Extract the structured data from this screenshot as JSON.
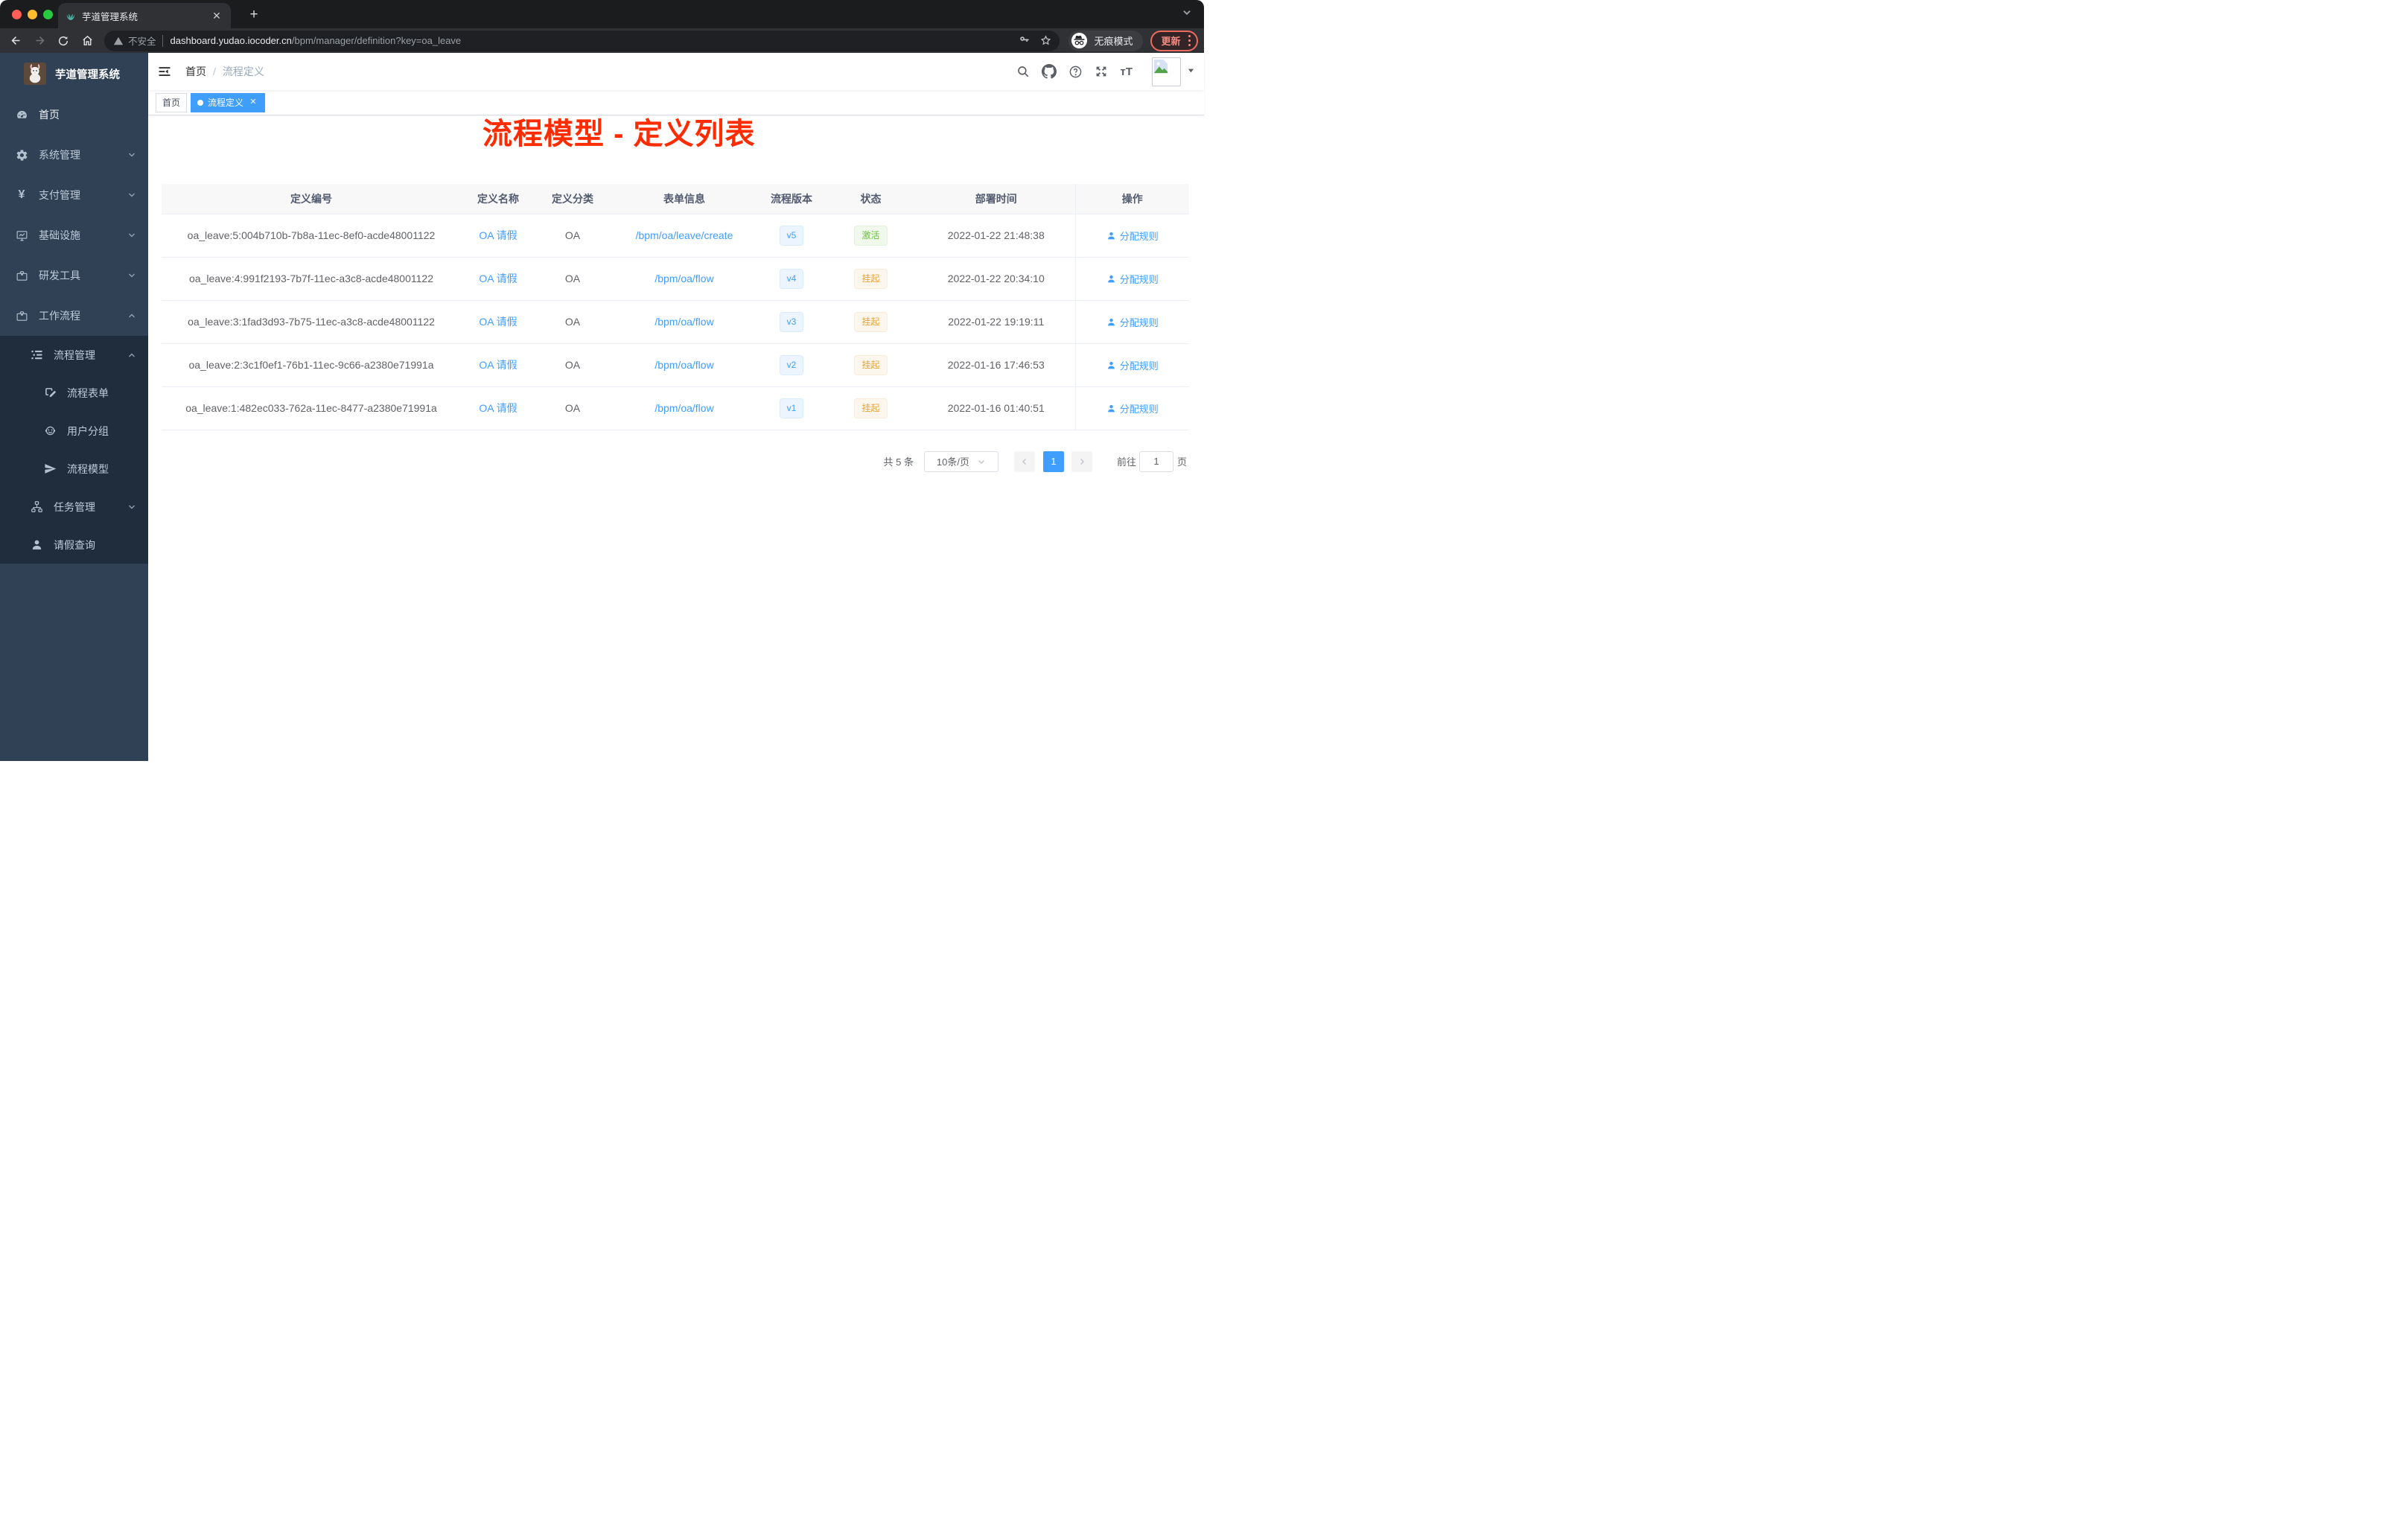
{
  "colors": {
    "accent": "#409eff",
    "success": "#67c23a",
    "warning": "#e6a23c",
    "annotation_red": "#fe2c00",
    "sidebar_bg": "#304156",
    "sidebar_submenu_bg": "#1f2d3d"
  },
  "browser": {
    "tab_title": "芋道管理系统",
    "security_label": "不安全",
    "url_domain": "dashboard.yudao.iocoder.cn",
    "url_path": "/bpm/manager/definition?key=oa_leave",
    "incognito_label": "无痕模式",
    "update_label": "更新"
  },
  "annotation": {
    "title": "流程模型 - 定义列表"
  },
  "sidebar": {
    "app_title": "芋道管理系统",
    "items": [
      {
        "key": "home",
        "label": "首页",
        "icon": "dashboard-icon",
        "level": 1,
        "bright": true
      },
      {
        "key": "system",
        "label": "系统管理",
        "icon": "gear-icon",
        "level": 1,
        "chevron": "down"
      },
      {
        "key": "payment",
        "label": "支付管理",
        "icon": "yen-icon",
        "level": 1,
        "chevron": "down"
      },
      {
        "key": "infrastructure",
        "label": "基础设施",
        "icon": "monitor-icon",
        "level": 1,
        "chevron": "down"
      },
      {
        "key": "dev-tools",
        "label": "研发工具",
        "icon": "toolbox-icon",
        "level": 1,
        "chevron": "down"
      },
      {
        "key": "workflow",
        "label": "工作流程",
        "icon": "toolbox-icon",
        "level": 1,
        "chevron": "up"
      },
      {
        "key": "process-mgmt",
        "label": "流程管理",
        "icon": "tree-list-icon",
        "level": 2,
        "chevron": "up",
        "dark": true
      },
      {
        "key": "process-form",
        "label": "流程表单",
        "icon": "form-icon",
        "level": 3,
        "dark": true
      },
      {
        "key": "user-group",
        "label": "用户分组",
        "icon": "people-icon",
        "level": 3,
        "dark": true
      },
      {
        "key": "process-model",
        "label": "流程模型",
        "icon": "paper-plane-icon",
        "level": 3,
        "dark": true
      },
      {
        "key": "task-mgmt",
        "label": "任务管理",
        "icon": "org-tree-icon",
        "level": 2,
        "chevron": "down",
        "dark": true
      },
      {
        "key": "leave-query",
        "label": "请假查询",
        "icon": "user-icon",
        "level": 2,
        "dark": true
      }
    ]
  },
  "breadcrumb": {
    "items": [
      "首页",
      "流程定义"
    ],
    "separator": "/"
  },
  "tags": [
    {
      "key": "home",
      "label": "首页",
      "active": false,
      "closable": false
    },
    {
      "key": "process-definition",
      "label": "流程定义",
      "active": true,
      "closable": true
    }
  ],
  "table": {
    "columns": [
      "定义编号",
      "定义名称",
      "定义分类",
      "表单信息",
      "流程版本",
      "状态",
      "部署时间",
      "操作"
    ],
    "rows": [
      {
        "id": "oa_leave:5:004b710b-7b8a-11ec-8ef0-acde48001122",
        "name": "OA 请假",
        "category": "OA",
        "form": "/bpm/oa/leave/create",
        "version": "v5",
        "status": "激活",
        "status_type": "success",
        "time": "2022-01-22 21:48:38",
        "action": "分配规则"
      },
      {
        "id": "oa_leave:4:991f2193-7b7f-11ec-a3c8-acde48001122",
        "name": "OA 请假",
        "category": "OA",
        "form": "/bpm/oa/flow",
        "version": "v4",
        "status": "挂起",
        "status_type": "warning",
        "time": "2022-01-22 20:34:10",
        "action": "分配规则"
      },
      {
        "id": "oa_leave:3:1fad3d93-7b75-11ec-a3c8-acde48001122",
        "name": "OA 请假",
        "category": "OA",
        "form": "/bpm/oa/flow",
        "version": "v3",
        "status": "挂起",
        "status_type": "warning",
        "time": "2022-01-22 19:19:11",
        "action": "分配规则"
      },
      {
        "id": "oa_leave:2:3c1f0ef1-76b1-11ec-9c66-a2380e71991a",
        "name": "OA 请假",
        "category": "OA",
        "form": "/bpm/oa/flow",
        "version": "v2",
        "status": "挂起",
        "status_type": "warning",
        "time": "2022-01-16 17:46:53",
        "action": "分配规则"
      },
      {
        "id": "oa_leave:1:482ec033-762a-11ec-8477-a2380e71991a",
        "name": "OA 请假",
        "category": "OA",
        "form": "/bpm/oa/flow",
        "version": "v1",
        "status": "挂起",
        "status_type": "warning",
        "time": "2022-01-16 01:40:51",
        "action": "分配规则"
      }
    ]
  },
  "pagination": {
    "total_label": "共 5 条",
    "page_size": "10条/页",
    "current_page": "1",
    "goto_label": "前往",
    "goto_value": "1",
    "page_unit": "页"
  }
}
